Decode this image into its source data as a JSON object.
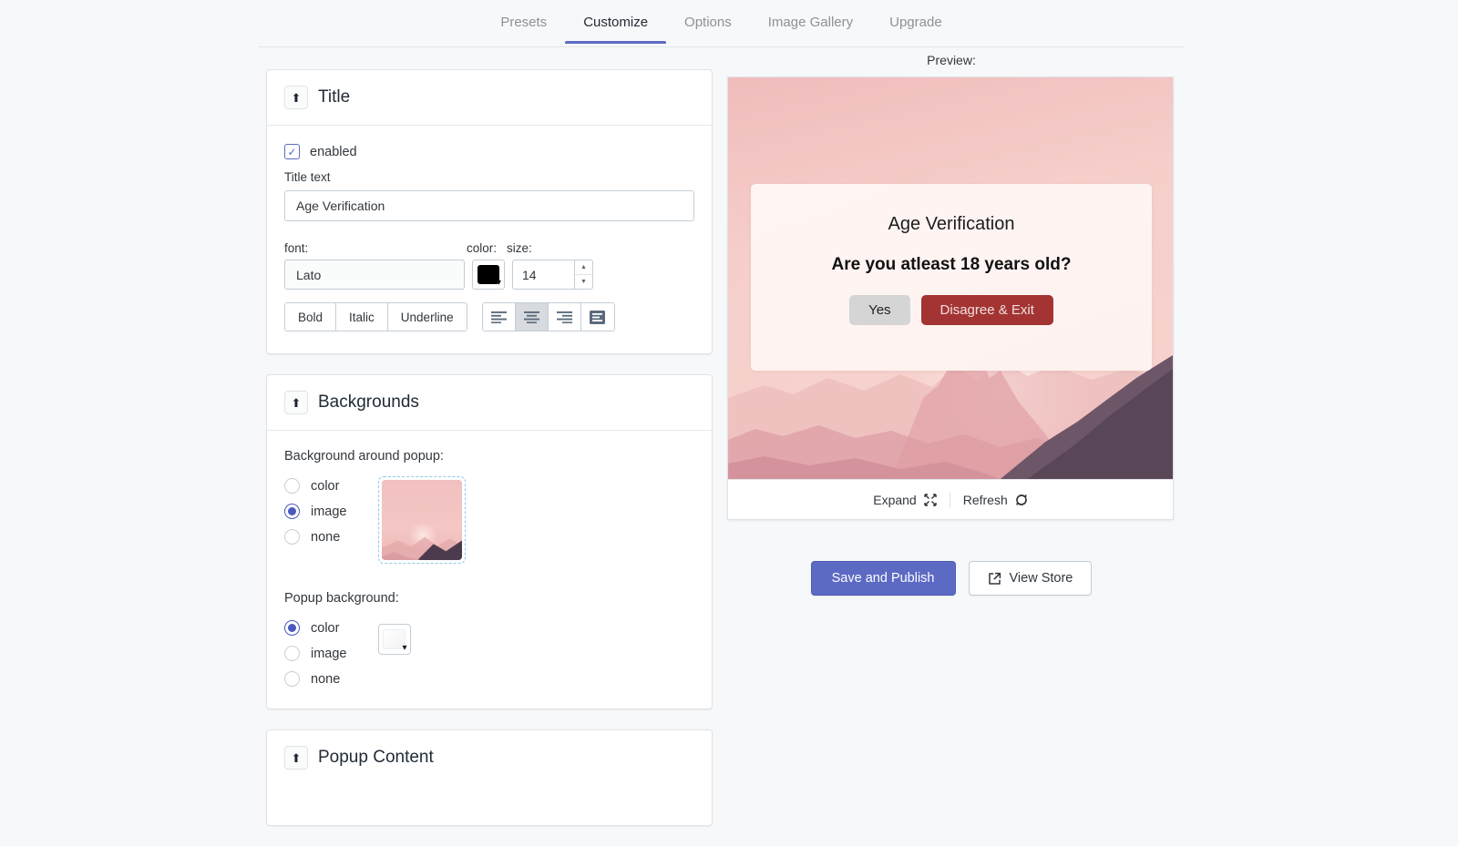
{
  "tabs": [
    {
      "label": "Presets",
      "active": false
    },
    {
      "label": "Customize",
      "active": true
    },
    {
      "label": "Options",
      "active": false
    },
    {
      "label": "Image Gallery",
      "active": false
    },
    {
      "label": "Upgrade",
      "active": false
    }
  ],
  "colors": {
    "accent": "#5c6ac4",
    "radio_checked": "#4959bd",
    "title_color_swatch": "#000000",
    "popup_bg_swatch": "#ffffff",
    "disagree_button": "#a43434",
    "yes_button": "#d5d5d5",
    "preview_bg_pink": "#f2c3c3"
  },
  "cards": {
    "title": {
      "heading": "Title",
      "collapse_icon": "arrow-up-icon",
      "enabled_label": "enabled",
      "enabled_checked": true,
      "title_text_label": "Title text",
      "title_text_value": "Age Verification",
      "font_label": "font:",
      "font_value": "Lato",
      "color_label": "color:",
      "size_label": "size:",
      "size_value": "14",
      "style_buttons": [
        "Bold",
        "Italic",
        "Underline"
      ],
      "align_buttons": [
        {
          "name": "align-left",
          "active": false
        },
        {
          "name": "align-center",
          "active": true
        },
        {
          "name": "align-right",
          "active": false
        },
        {
          "name": "align-justify",
          "active": false
        }
      ]
    },
    "backgrounds": {
      "heading": "Backgrounds",
      "collapse_icon": "arrow-up-icon",
      "around_popup_label": "Background around popup:",
      "around_popup_options": [
        {
          "label": "color",
          "selected": false
        },
        {
          "label": "image",
          "selected": true
        },
        {
          "label": "none",
          "selected": false
        }
      ],
      "popup_background_label": "Popup background:",
      "popup_background_options": [
        {
          "label": "color",
          "selected": true
        },
        {
          "label": "image",
          "selected": false
        },
        {
          "label": "none",
          "selected": false
        }
      ]
    },
    "popup_content": {
      "heading": "Popup Content",
      "collapse_icon": "arrow-up-icon"
    }
  },
  "preview": {
    "caption": "Preview:",
    "popup_title": "Age Verification",
    "popup_question": "Are you atleast 18 years old?",
    "agree_button": "Yes",
    "disagree_button": "Disagree & Exit",
    "expand_label": "Expand",
    "expand_icon": "expand-arrows-icon",
    "refresh_label": "Refresh",
    "refresh_icon": "refresh-icon"
  },
  "actions": {
    "save_label": "Save and Publish",
    "view_store_label": "View Store",
    "view_store_icon": "external-link-icon"
  }
}
